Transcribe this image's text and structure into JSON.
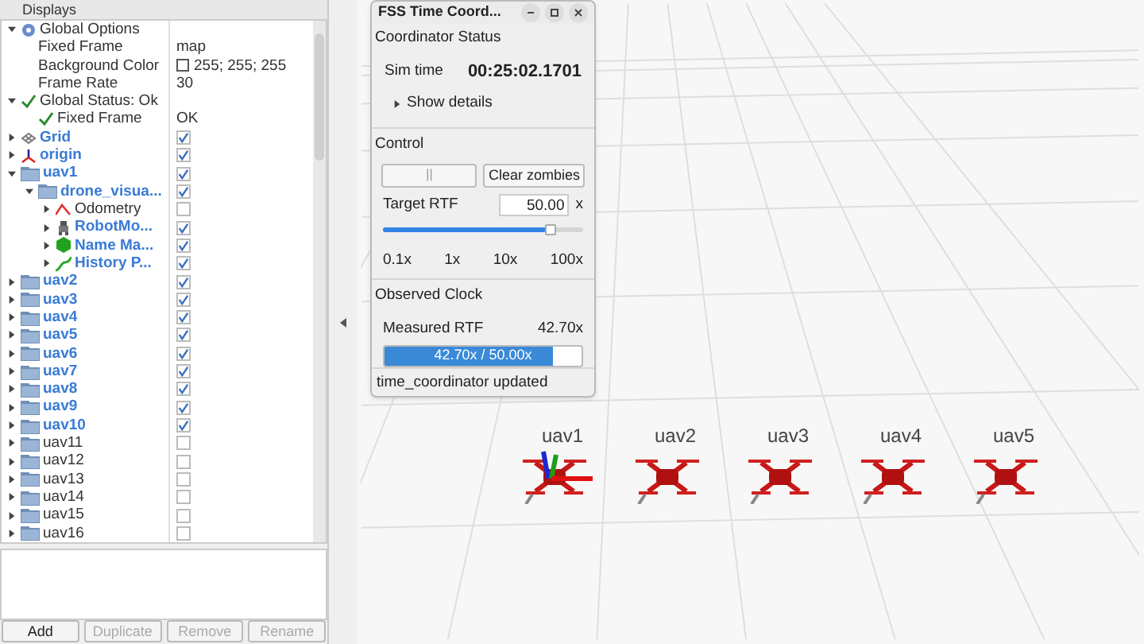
{
  "displays_panel": {
    "title": "Displays",
    "tree": [
      {
        "label": "Global Options",
        "kind": "gear",
        "expanded": true,
        "children": [
          {
            "label": "Fixed Frame",
            "kind": "property",
            "value": "map"
          },
          {
            "label": "Background Color",
            "kind": "color_property",
            "value": "255; 255; 255"
          },
          {
            "label": "Frame Rate",
            "kind": "property",
            "value": "30"
          }
        ]
      },
      {
        "label": "Global Status: Ok",
        "kind": "check",
        "expanded": true,
        "children": [
          {
            "label": "Fixed Frame",
            "kind": "check",
            "value": "OK"
          }
        ]
      },
      {
        "label": "Grid",
        "kind": "grid",
        "expanded": false,
        "checked": true
      },
      {
        "label": "origin",
        "kind": "axes",
        "expanded": false,
        "checked": true
      },
      {
        "label": "uav1",
        "kind": "folder",
        "expanded": true,
        "checked": true,
        "children": [
          {
            "label": "drone_visua...",
            "kind": "folder",
            "expanded": true,
            "checked": true,
            "children": [
              {
                "label": "Odometry",
                "kind": "odometry",
                "expanded": false,
                "checked": false
              },
              {
                "label": "RobotMo...",
                "kind": "robot",
                "expanded": false,
                "checked": true
              },
              {
                "label": "Name Ma...",
                "kind": "hexagon",
                "expanded": false,
                "checked": true
              },
              {
                "label": "History P...",
                "kind": "path",
                "expanded": false,
                "checked": true
              }
            ]
          }
        ]
      },
      {
        "label": "uav2",
        "kind": "folder",
        "expanded": false,
        "checked": true
      },
      {
        "label": "uav3",
        "kind": "folder",
        "expanded": false,
        "checked": true
      },
      {
        "label": "uav4",
        "kind": "folder",
        "expanded": false,
        "checked": true
      },
      {
        "label": "uav5",
        "kind": "folder",
        "expanded": false,
        "checked": true
      },
      {
        "label": "uav6",
        "kind": "folder",
        "expanded": false,
        "checked": true
      },
      {
        "label": "uav7",
        "kind": "folder",
        "expanded": false,
        "checked": true
      },
      {
        "label": "uav8",
        "kind": "folder",
        "expanded": false,
        "checked": true
      },
      {
        "label": "uav9",
        "kind": "folder",
        "expanded": false,
        "checked": true
      },
      {
        "label": "uav10",
        "kind": "folder",
        "expanded": false,
        "checked": true
      },
      {
        "label": "uav11",
        "kind": "folder",
        "expanded": false,
        "checked": false
      },
      {
        "label": "uav12",
        "kind": "folder",
        "expanded": false,
        "checked": false
      },
      {
        "label": "uav13",
        "kind": "folder",
        "expanded": false,
        "checked": false
      },
      {
        "label": "uav14",
        "kind": "folder",
        "expanded": false,
        "checked": false
      },
      {
        "label": "uav15",
        "kind": "folder",
        "expanded": false,
        "checked": false
      },
      {
        "label": "uav16",
        "kind": "folder",
        "expanded": false,
        "checked": false
      }
    ],
    "buttons": [
      {
        "label": "Add",
        "disabled": false
      },
      {
        "label": "Duplicate",
        "disabled": true
      },
      {
        "label": "Remove",
        "disabled": true
      },
      {
        "label": "Rename",
        "disabled": true
      }
    ]
  },
  "coordinator_window": {
    "title": "FSS Time Coord...",
    "status": {
      "heading": "Coordinator Status",
      "sim_time_label": "Sim time",
      "sim_time": "00:25:02.1701",
      "details_toggle": "Show details",
      "details_expanded": false
    },
    "control": {
      "heading": "Control",
      "pause_symbol": "||",
      "clear_button": "Clear zombies",
      "target_label": "Target RTF",
      "target_value": "50.00",
      "target_unit": "x",
      "slider": {
        "level": 0.83,
        "tick_labels": [
          "0.1x",
          "1x",
          "10x",
          "100x"
        ]
      }
    },
    "observed": {
      "heading": "Observed Clock",
      "measured_label": "Measured RTF",
      "measured_value": "42.70x",
      "progress": {
        "level": 0.854,
        "text": "42.70x / 50.00x"
      }
    },
    "status_bar": "time_coordinator updated"
  },
  "viewport": {
    "drones": [
      {
        "label": "uav1",
        "axes": true
      },
      {
        "label": "uav2",
        "axes": false
      },
      {
        "label": "uav3",
        "axes": false
      },
      {
        "label": "uav4",
        "axes": false
      },
      {
        "label": "uav5",
        "axes": false
      }
    ]
  }
}
